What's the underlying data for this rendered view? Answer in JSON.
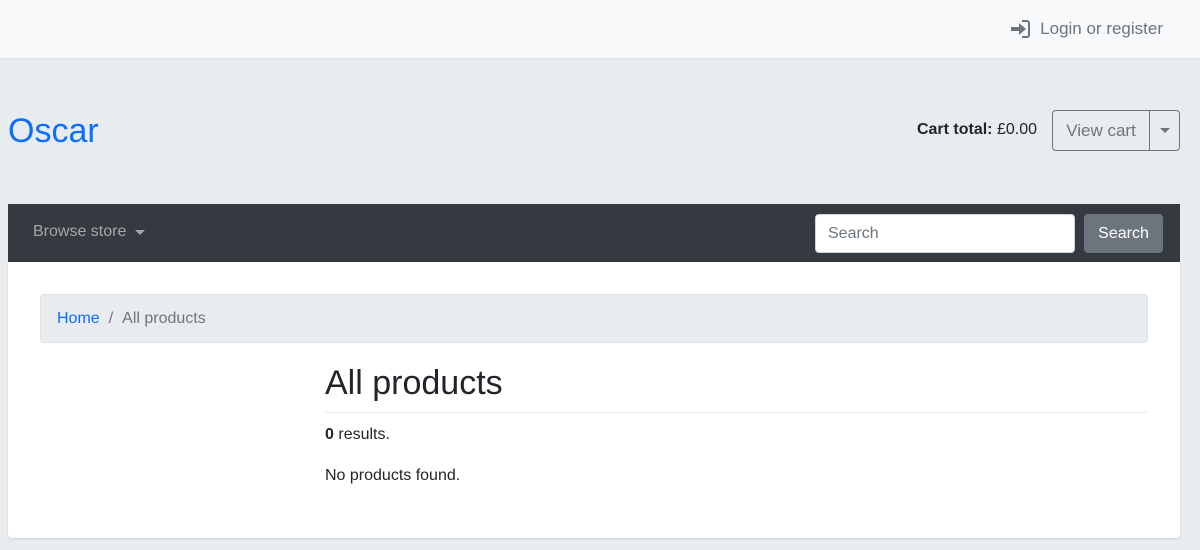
{
  "topbar": {
    "login_label": "Login or register",
    "login_icon": "sign-in-icon"
  },
  "header": {
    "brand": "Oscar",
    "cart_total_label": "Cart total:",
    "cart_total_value": "£0.00",
    "view_cart_label": "View cart"
  },
  "navbar": {
    "browse_label": "Browse store",
    "search_placeholder": "Search",
    "search_value": "",
    "search_button_label": "Search"
  },
  "breadcrumb": {
    "items": [
      {
        "label": "Home",
        "link": true
      },
      {
        "label": "All products",
        "link": false
      }
    ],
    "separator": "/"
  },
  "main": {
    "title": "All products",
    "results_count": "0",
    "results_suffix": "results.",
    "empty_message": "No products found."
  },
  "colors": {
    "accent": "#0d6efd",
    "navbar_bg": "#343a40",
    "secondary": "#6c757d",
    "page_bg": "#e9ecef"
  }
}
